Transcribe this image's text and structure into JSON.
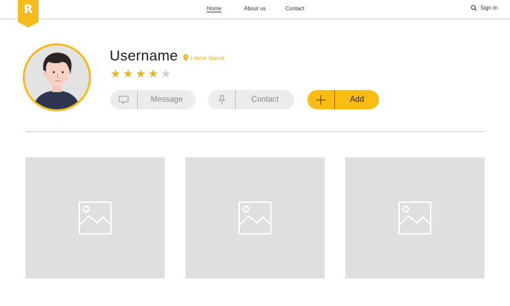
{
  "logo": {
    "letter": "R",
    "color": "#f5bb1a"
  },
  "nav": {
    "items": [
      {
        "label": "Home",
        "active": true
      },
      {
        "label": "About us",
        "active": false
      },
      {
        "label": "Contact",
        "active": false
      }
    ],
    "signin": {
      "label": "Sign In",
      "icon": "search-icon"
    }
  },
  "profile": {
    "username": "Username",
    "location": {
      "icon": "location-pin-icon",
      "label": "Lorem Ipsum"
    },
    "rating": {
      "value": 4,
      "max": 5
    },
    "avatar": {
      "icon": "user-avatar"
    }
  },
  "actions": {
    "message": {
      "label": "Message",
      "icon": "chat-bubble-icon"
    },
    "contact": {
      "label": "Contact",
      "icon": "pin-icon"
    },
    "add": {
      "label": "Add",
      "icon": "plus-icon"
    }
  },
  "gallery": {
    "items": [
      {
        "icon": "image-placeholder-icon"
      },
      {
        "icon": "image-placeholder-icon"
      },
      {
        "icon": "image-placeholder-icon"
      }
    ]
  },
  "colors": {
    "accent": "#f5bb1a",
    "star": "#e5b528",
    "placeholder": "#dfdfdf"
  }
}
